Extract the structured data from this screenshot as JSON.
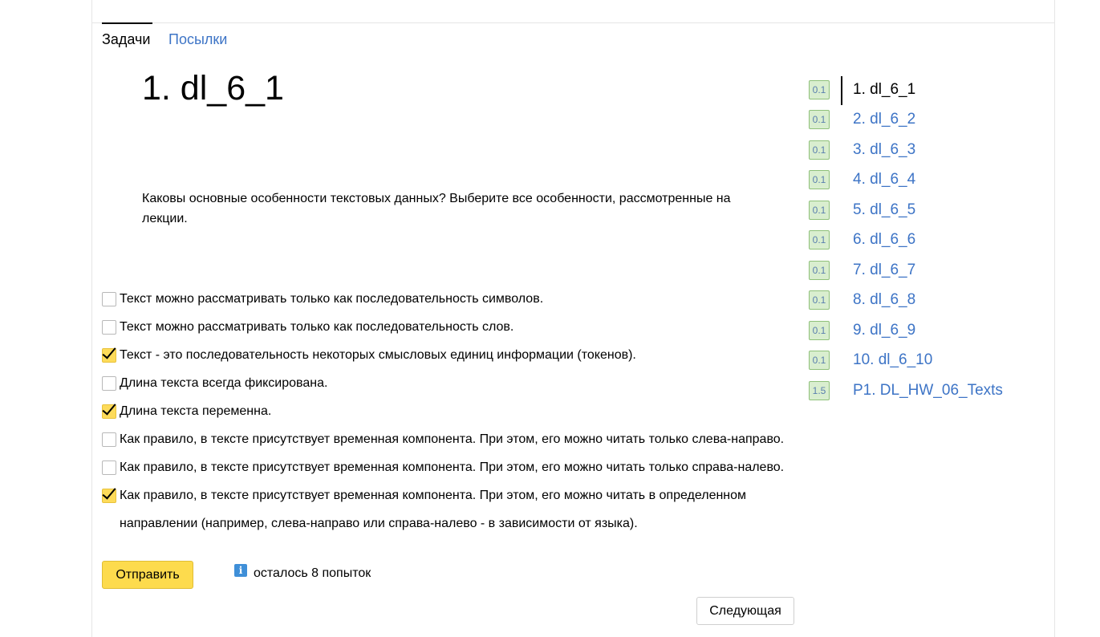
{
  "tabs": {
    "problems": "Задачи",
    "submissions": "Посылки"
  },
  "problem": {
    "title": "1. dl_6_1",
    "statement": "Каковы основные особенности текстовых данных? Выберите все особенности, рассмотренные на лекции."
  },
  "options": [
    {
      "label": "Текст можно рассматривать только как последовательность символов.",
      "checked": false
    },
    {
      "label": "Текст можно рассматривать только как последовательность слов.",
      "checked": false
    },
    {
      "label": "Текст - это последовательность некоторых смысловых единиц информации (токенов).",
      "checked": true
    },
    {
      "label": "Длина текста всегда фиксирована.",
      "checked": false
    },
    {
      "label": "Длина текста переменна.",
      "checked": true
    },
    {
      "label": "Как правило, в тексте присутствует временная компонента. При этом, его можно читать только слева-направо.",
      "checked": false
    },
    {
      "label": "Как правило, в тексте присутствует временная компонента. При этом, его можно читать только справа-налево.",
      "checked": false
    },
    {
      "label_line1": "Как правило, в тексте присутствует временная компонента. При этом, его можно читать в определенном",
      "label_line2": "направлении (например, слева-направо или справа-налево - в зависимости от языка).",
      "checked": true
    }
  ],
  "submit_label": "Отправить",
  "attempts_text": "осталось 8 попыток",
  "next_label": "Следующая",
  "nav": [
    {
      "score": "0.1",
      "label": "1. dl_6_1",
      "current": true
    },
    {
      "score": "0.1",
      "label": "2. dl_6_2"
    },
    {
      "score": "0.1",
      "label": "3. dl_6_3"
    },
    {
      "score": "0.1",
      "label": "4. dl_6_4"
    },
    {
      "score": "0.1",
      "label": "5. dl_6_5"
    },
    {
      "score": "0.1",
      "label": "6. dl_6_6"
    },
    {
      "score": "0.1",
      "label": "7. dl_6_7"
    },
    {
      "score": "0.1",
      "label": "8. dl_6_8"
    },
    {
      "score": "0.1",
      "label": "9. dl_6_9"
    },
    {
      "score": "0.1",
      "label": "10. dl_6_10"
    },
    {
      "score": "1.5",
      "label": "P1. DL_HW_06_Texts"
    }
  ],
  "colors": {
    "accent_yellow": "#fddb4d",
    "link_blue": "#3d74c6",
    "score_bg": "#d9eecf",
    "info_blue": "#3f8fd8"
  }
}
